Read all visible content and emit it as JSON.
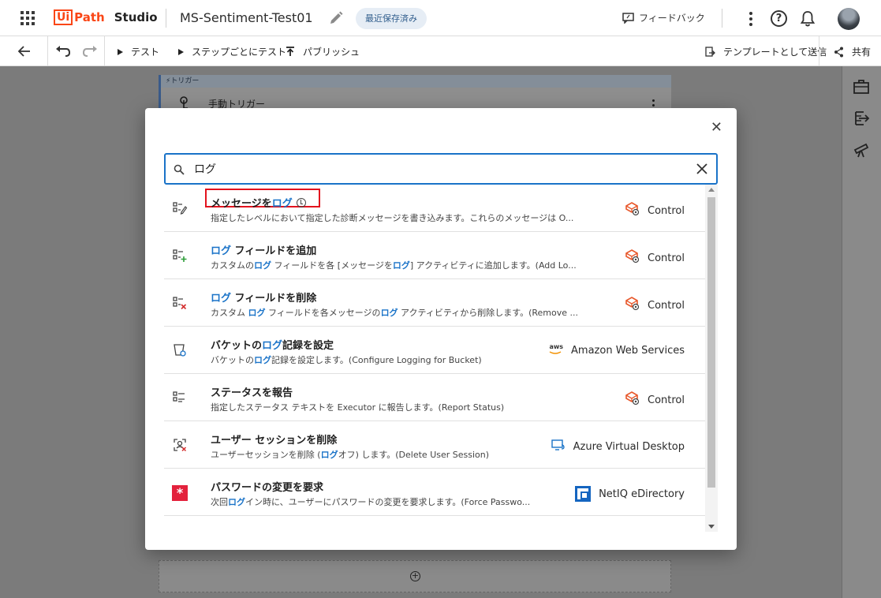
{
  "app": {
    "logo_ui": "Ui",
    "logo_path": "Path",
    "product": "Studio",
    "project_name": "MS-Sentiment-Test01",
    "save_status": "最近保存済み",
    "feedback_label": "フィードバック"
  },
  "toolbar": {
    "test_label": "テスト",
    "step_test_label": "ステップごとにテスト",
    "publish_label": "パブリッシュ",
    "send_template_label": "テンプレートとして送信",
    "share_label": "共有"
  },
  "canvas": {
    "trigger_header": "トリガー",
    "trigger_name": "手動トリガー"
  },
  "search": {
    "value": "ログ",
    "placeholder": ""
  },
  "results": [
    {
      "title_pre": "メッセージを",
      "title_hl": "ログ",
      "title_post": "",
      "desc": "指定したレベルにおいて指定した診断メッセージを書き込みます。これらのメッセージは O...",
      "category": "Control",
      "icon": "log-message-icon",
      "cat_icon": "control-package-icon",
      "has_clock": true
    },
    {
      "title_pre": "",
      "title_hl": "ログ",
      "title_post": " フィールドを追加",
      "desc_parts": [
        "カスタムの",
        "ログ",
        " フィールドを各 [メッセージを",
        "ログ",
        "] アクティビティに追加します。(Add Lo..."
      ],
      "category": "Control",
      "icon": "add-log-fields-icon",
      "cat_icon": "control-package-icon"
    },
    {
      "title_pre": "",
      "title_hl": "ログ",
      "title_post": " フィールドを削除",
      "desc_parts": [
        "カスタム ",
        "ログ",
        " フィールドを各メッセージの",
        "ログ",
        " アクティビティから削除します。(Remove ..."
      ],
      "category": "Control",
      "icon": "remove-log-fields-icon",
      "cat_icon": "control-package-icon"
    },
    {
      "title_pre": "バケットの",
      "title_hl": "ログ",
      "title_post": "記録を設定",
      "desc_parts": [
        "バケットの",
        "ログ",
        "記録を設定します。(Configure Logging for Bucket)"
      ],
      "category": "Amazon Web Services",
      "icon": "bucket-icon",
      "cat_icon": "aws-icon"
    },
    {
      "title_pre": "ステータスを報告",
      "title_hl": "",
      "title_post": "",
      "desc": "指定したステータス テキストを Executor に報告します。(Report Status)",
      "category": "Control",
      "icon": "report-status-icon",
      "cat_icon": "control-package-icon"
    },
    {
      "title_pre": "ユーザー セッションを削除",
      "title_hl": "",
      "title_post": "",
      "desc_parts": [
        "ユーザーセッションを削除 (",
        "ログ",
        "オフ) します。(Delete User Session)"
      ],
      "category": "Azure Virtual Desktop",
      "icon": "delete-session-icon",
      "cat_icon": "azure-desktop-icon"
    },
    {
      "title_pre": "パスワードの変更を要求",
      "title_hl": "",
      "title_post": "",
      "desc_parts": [
        "次回",
        "ログ",
        "イン時に、ユーザーにパスワードの変更を要求します。(Force Passwo..."
      ],
      "category": "NetIQ eDirectory",
      "icon": "password-change-icon",
      "cat_icon": "netiq-icon"
    }
  ],
  "colors": {
    "accent": "#1a73c8",
    "brand": "#fa4616",
    "highlight_border": "#e3131e"
  }
}
